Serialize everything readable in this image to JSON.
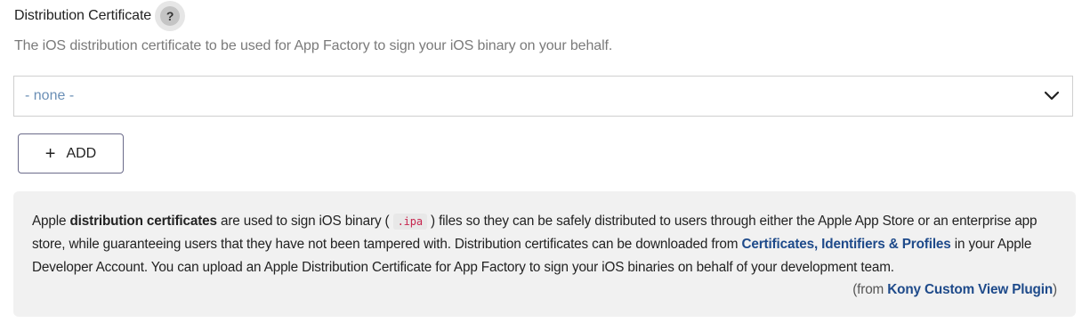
{
  "field": {
    "label": "Distribution Certificate",
    "help_symbol": "?",
    "description": "The iOS distribution certificate to be used for App Factory to sign your iOS binary on your behalf."
  },
  "select": {
    "value": "- none -",
    "icon": "chevron-down-icon"
  },
  "add_button": {
    "symbol": "+",
    "label": "ADD"
  },
  "info": {
    "t1": "Apple ",
    "bold1": "distribution certificates",
    "t2": " are used to sign iOS binary ( ",
    "code": ".ipa",
    "t3": " ) files so they can be safely distributed to users through either the Apple App Store or an enterprise app store, while guaranteeing users that they have not been tampered with. Distribution certificates can be downloaded from ",
    "link1": "Certificates, Identifiers & Profiles",
    "t4": " in your Apple Developer Account. You can upload an Apple Distribution Certificate for App Factory to sign your iOS binaries on behalf of your development team.",
    "source_prefix": "(from ",
    "source_link": "Kony Custom View Plugin",
    "source_suffix": ")"
  },
  "colors": {
    "link": "#1e4a8a",
    "placeholder": "#6b8fb6",
    "code": "#c7254e",
    "info_background": "#f1f1f1"
  }
}
